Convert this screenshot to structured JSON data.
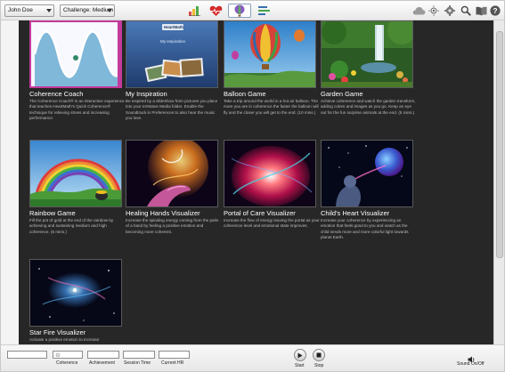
{
  "toolbar": {
    "user_select": "John Doe",
    "challenge_select": "Challenge: Medium",
    "icons": [
      "bar-chart-icon",
      "heart-icon",
      "balloon-icon",
      "list-icon",
      "cloud-icon",
      "sun-icon",
      "settings-icon",
      "search-icon",
      "book-icon",
      "help-icon"
    ]
  },
  "tiles": [
    {
      "title": "Coherence Coach",
      "desc": "The Coherence Coach® is an interactive experience that teaches HeartMath's Quick Coherence® technique for relieving stress and increasing performance.",
      "image": "coherence-coach"
    },
    {
      "title": "My Inspiration",
      "desc": "Be inspired by a slideshow from pictures you place into your emWave Media folder. Enable the Soundtrack in Preferences to also hear the music you love.",
      "image": "my-inspiration",
      "image_caption": "My Inspiration",
      "image_logo": "HeartMath"
    },
    {
      "title": "Balloon Game",
      "desc": "Take a trip around the world in a hot air balloon. The more you are in coherence the faster the balloon will fly and the closer you will get to the end. (10 mins.)",
      "image": "balloon-game"
    },
    {
      "title": "Garden Game",
      "desc": "Achieve coherence and watch the garden transform, adding colors and images as you go. Keep an eye out for the fun surprise animals at the end. (5 mins.)",
      "image": "garden-game"
    },
    {
      "title": "Rainbow Game",
      "desc": "Fill the pot of gold at the end of the rainbow by achieving and sustaining medium and high coherence. (5 mins.)",
      "image": "rainbow-game"
    },
    {
      "title": "Healing Hands Visualizer",
      "desc": "Increase the spiraling energy coming from the palm of a hand by feeling a positive emotion and becoming more coherent.",
      "image": "healing-hands"
    },
    {
      "title": "Portal of Care Visualizer",
      "desc": "Increase the flow of energy leaving the portal as your coherence level and emotional state improves.",
      "image": "portal-of-care"
    },
    {
      "title": "Child's Heart Visualizer",
      "desc": "Increase your coherence by experiencing an emotion that feels good to you and watch as the child sends more and more colorful light towards planet Earth.",
      "image": "childs-heart"
    },
    {
      "title": "Star Fire Visualizer",
      "desc": "Activate a positive emotion to increase",
      "image": "star-fire"
    }
  ],
  "bottom": {
    "coherence_label": "Coherence",
    "achievement_label": "Achievement",
    "session_time_label": "Session Time",
    "current_hr_label": "Current HR",
    "start_label": "Start",
    "stop_label": "Stop",
    "sound_label": "Sound On/Off"
  }
}
